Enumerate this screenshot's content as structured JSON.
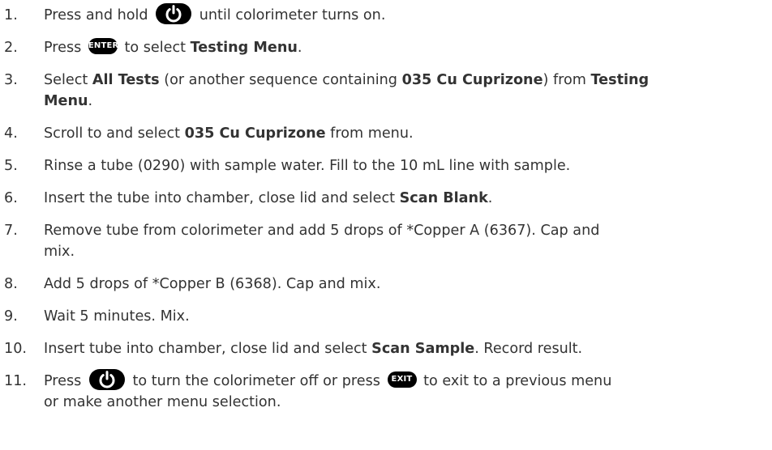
{
  "steps": [
    {
      "num": "1.",
      "parts": [
        {
          "t": "Press and hold "
        },
        {
          "icon": "power"
        },
        {
          "t": " until colorimeter turns on."
        }
      ]
    },
    {
      "num": "2.",
      "parts": [
        {
          "t": "Press "
        },
        {
          "icon": "enter"
        },
        {
          "t": " to select "
        },
        {
          "t": "Testing Menu",
          "b": true
        },
        {
          "t": "."
        }
      ]
    },
    {
      "num": "3.",
      "lines": [
        [
          {
            "t": "Select "
          },
          {
            "t": "All Tests",
            "b": true
          },
          {
            "t": " (or another sequence containing "
          },
          {
            "t": "035 Cu Cuprizone",
            "b": true
          },
          {
            "t": ") from "
          },
          {
            "t": "Testing",
            "b": true
          }
        ],
        [
          {
            "t": "Menu",
            "b": true
          },
          {
            "t": "."
          }
        ]
      ]
    },
    {
      "num": "4.",
      "parts": [
        {
          "t": "Scroll to and select "
        },
        {
          "t": "035 Cu Cuprizone",
          "b": true
        },
        {
          "t": " from menu."
        }
      ]
    },
    {
      "num": "5.",
      "parts": [
        {
          "t": "Rinse a tube (0290) with sample water. Fill to the 10 mL line with sample."
        }
      ]
    },
    {
      "num": "6.",
      "parts": [
        {
          "t": "Insert the tube into chamber, close lid and select "
        },
        {
          "t": "Scan Blank",
          "b": true
        },
        {
          "t": "."
        }
      ]
    },
    {
      "num": "7.",
      "lines": [
        [
          {
            "t": "Remove tube from colorimeter and add 5 drops of *Copper A (6367). Cap and"
          }
        ],
        [
          {
            "t": "mix."
          }
        ]
      ]
    },
    {
      "num": "8.",
      "parts": [
        {
          "t": "Add 5 drops of *Copper B (6368). Cap and mix."
        }
      ]
    },
    {
      "num": "9.",
      "parts": [
        {
          "t": "Wait 5 minutes. Mix."
        }
      ]
    },
    {
      "num": "10.",
      "parts": [
        {
          "t": "Insert tube into chamber, close lid and select "
        },
        {
          "t": "Scan Sample",
          "b": true
        },
        {
          "t": ". Record result."
        }
      ]
    },
    {
      "num": "11.",
      "lines": [
        [
          {
            "t": "Press "
          },
          {
            "icon": "power"
          },
          {
            "t": " to turn the colorimeter off or press "
          },
          {
            "icon": "exit"
          },
          {
            "t": " to exit to a previous menu"
          }
        ],
        [
          {
            "t": "or make another menu selection."
          }
        ]
      ]
    }
  ],
  "buttons": {
    "enter_label": "ENTER",
    "exit_label": "EXIT"
  },
  "colors": {
    "text": "#333333",
    "button_fill": "#000000",
    "button_text": "#ffffff"
  }
}
